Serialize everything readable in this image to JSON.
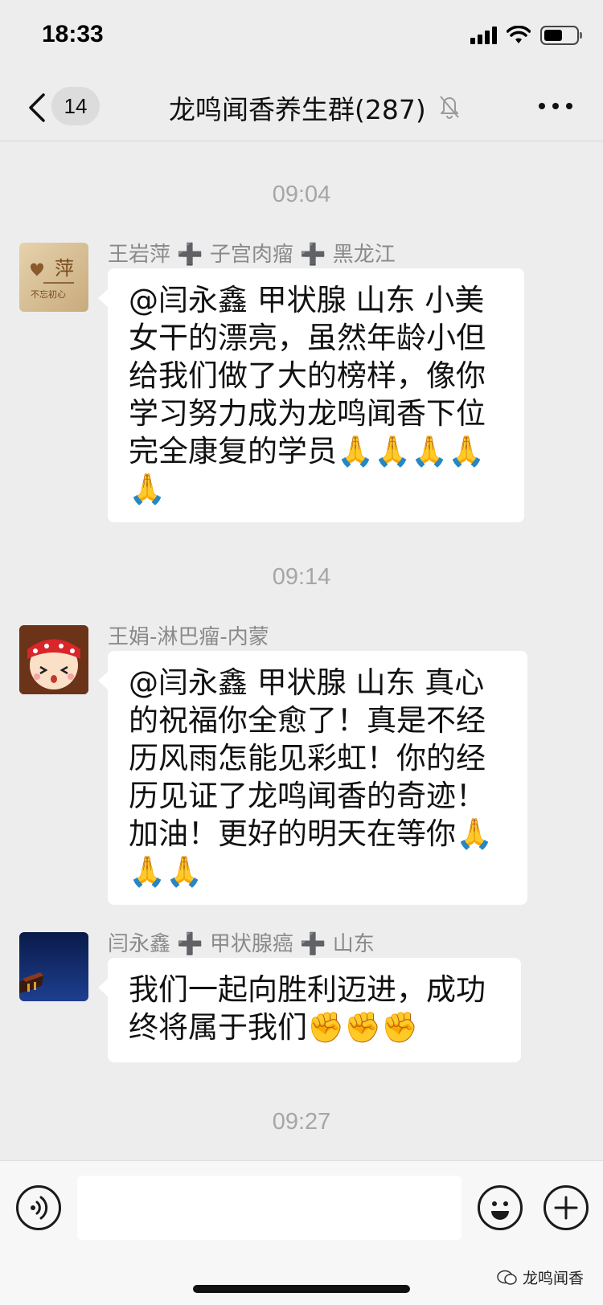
{
  "status_bar": {
    "time": "18:33"
  },
  "nav": {
    "unread_count": "14",
    "title": "龙鸣闻香养生群(287)"
  },
  "chat": {
    "time_dividers": [
      "09:04",
      "09:14",
      "09:27"
    ],
    "messages": [
      {
        "sender": "王岩萍 ➕ 子宫肉瘤 ➕ 黑龙江",
        "text": "@闫永鑫  甲状腺  山东 小美女干的漂亮，虽然年龄小但给我们做了大的榜样，像你学习努力成为龙鸣闻香下位完全康复的学员🙏🙏🙏🙏🙏"
      },
      {
        "sender": "王娟-淋巴瘤-内蒙",
        "text": "@闫永鑫  甲状腺  山东 真心的祝福你全愈了！真是不经历风雨怎能见彩虹！你的经历见证了龙鸣闻香的奇迹！加油！更好的明天在等你🙏🙏🙏"
      },
      {
        "sender": "闫永鑫 ➕ 甲状腺癌 ➕ 山东",
        "text": "我们一起向胜利迈进，成功终将属于我们✊✊✊"
      }
    ]
  },
  "input_bar": {
    "placeholder": ""
  },
  "watermark": {
    "text": "龙鸣闻香"
  },
  "colors": {
    "background": "#ededed",
    "bubble": "#ffffff",
    "timestamp": "#a6a6a6"
  }
}
